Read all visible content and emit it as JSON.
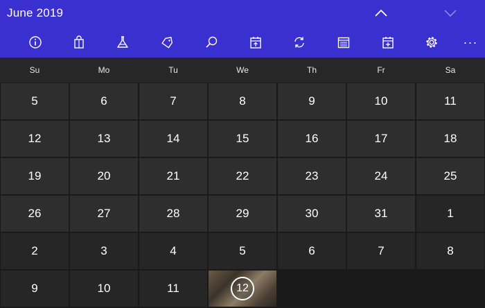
{
  "header": {
    "title": "June 2019"
  },
  "nav": {
    "up_icon": "chevron-up-icon",
    "down_icon": "chevron-down-icon"
  },
  "toolbar": {
    "items": [
      {
        "icon": "info-icon"
      },
      {
        "icon": "shopping-bag-icon"
      },
      {
        "icon": "flask-icon"
      },
      {
        "icon": "tag-icon"
      },
      {
        "icon": "search-icon"
      },
      {
        "icon": "calendar-upload-icon"
      },
      {
        "icon": "sync-icon"
      },
      {
        "icon": "calendar-list-icon"
      },
      {
        "icon": "calendar-add-icon"
      },
      {
        "icon": "gear-icon"
      }
    ],
    "more_label": "···"
  },
  "days": [
    "Su",
    "Mo",
    "Tu",
    "We",
    "Th",
    "Fr",
    "Sa"
  ],
  "weeks": [
    [
      "5",
      "6",
      "7",
      "8",
      "9",
      "10",
      "11"
    ],
    [
      "12",
      "13",
      "14",
      "15",
      "16",
      "17",
      "18"
    ],
    [
      "19",
      "20",
      "21",
      "22",
      "23",
      "24",
      "25"
    ],
    [
      "26",
      "27",
      "28",
      "29",
      "30",
      "31",
      "1"
    ],
    [
      "2",
      "3",
      "4",
      "5",
      "6",
      "7",
      "8"
    ],
    [
      "9",
      "10",
      "11",
      "12"
    ]
  ],
  "today": "12",
  "colors": {
    "accent": "#3a2fcf",
    "cell": "#2e2e2e",
    "header_row": "#272727",
    "background": "#1a1a1a"
  }
}
